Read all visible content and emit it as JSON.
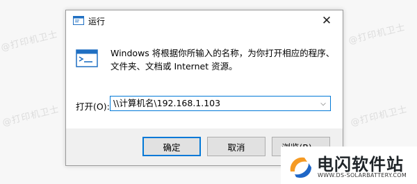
{
  "watermark": "@打印机卫士",
  "dialog": {
    "title": "运行",
    "close_glyph": "✕",
    "description": "Windows 将根据你所输入的名称，为你打开相应的程序、文件夹、文档或 Internet 资源。",
    "open_label": "打开(O):",
    "input_value": "\\\\计算机名\\192.168.1.103",
    "dropdown_glyph": "⌵",
    "buttons": {
      "ok": "确定",
      "cancel": "取消",
      "browse": "浏览(B)..."
    }
  },
  "brand": {
    "name": "电闪软件站",
    "url": "WWW.DS-SOLARBATTERY.COM",
    "colors": {
      "orange": "#f59a23",
      "blue": "#1e66c7"
    }
  }
}
